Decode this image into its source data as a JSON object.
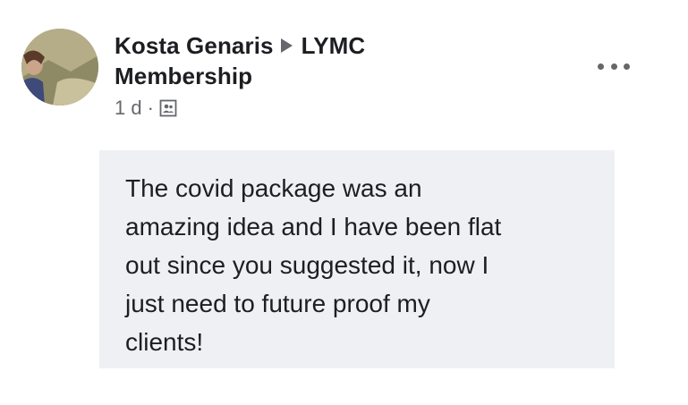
{
  "post": {
    "author": "Kosta Genaris",
    "group": "LYMC",
    "group_line2": "Membership",
    "timestamp": "1 d",
    "separator": "·",
    "audience_icon": "group-members-icon",
    "more_icon": "more-options-icon",
    "comment_text": "The covid package was an\namazing idea and I have been flat\nout since you suggested it, now I\njust need to future proof my\nclients!"
  },
  "colors": {
    "text_primary": "#1c1e21",
    "text_secondary": "#65676b",
    "bubble_bg": "#eef0f4"
  }
}
